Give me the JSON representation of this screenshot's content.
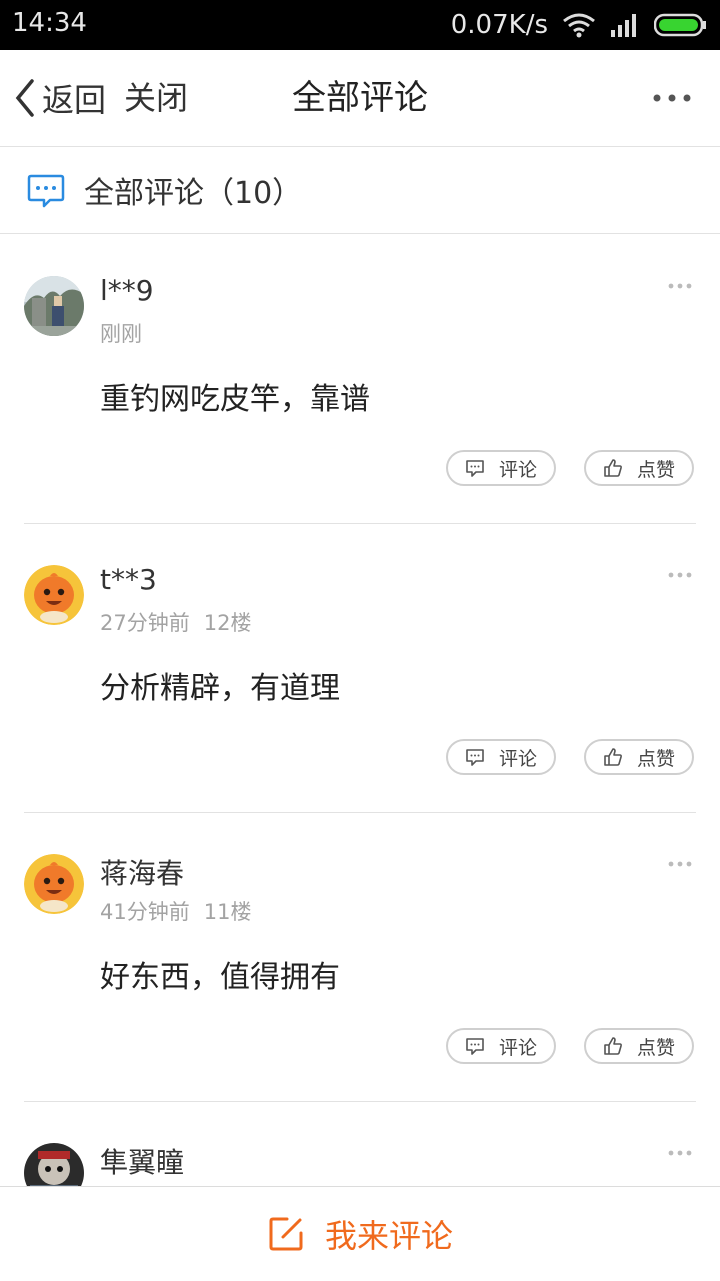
{
  "status_bar": {
    "time": "14:34",
    "speed": "0.07K/s",
    "icons": [
      "wifi-icon",
      "signal-icon",
      "battery-icon"
    ]
  },
  "nav": {
    "back_label": "返回",
    "close_label": "关闭",
    "title": "全部评论",
    "more_icon": "more-dots-icon"
  },
  "section": {
    "title": "全部评论（10）",
    "icon": "comment-bubble-icon",
    "accent": "#2a8be0"
  },
  "comments": [
    {
      "user": "l**9",
      "time": "刚刚",
      "floor": "",
      "text": "重钓网吃皮竿，靠谱",
      "comment_btn": "评论",
      "like_btn": "点赞",
      "avatar": "photo-avatar"
    },
    {
      "user": "t**3",
      "time": "27分钟前",
      "floor": "12楼",
      "text": "分析精辟，有道理",
      "comment_btn": "评论",
      "like_btn": "点赞",
      "avatar": "mascot-avatar"
    },
    {
      "user": "蒋海春",
      "time": "41分钟前",
      "floor": "11楼",
      "text": "好东西，值得拥有",
      "comment_btn": "评论",
      "like_btn": "点赞",
      "avatar": "mascot-avatar"
    },
    {
      "user": "隼翼瞳",
      "time": "",
      "floor": "",
      "text": "",
      "avatar": "photo-avatar"
    }
  ],
  "bottom": {
    "label": "我来评论",
    "icon": "edit-icon",
    "color": "#f06a1d"
  }
}
